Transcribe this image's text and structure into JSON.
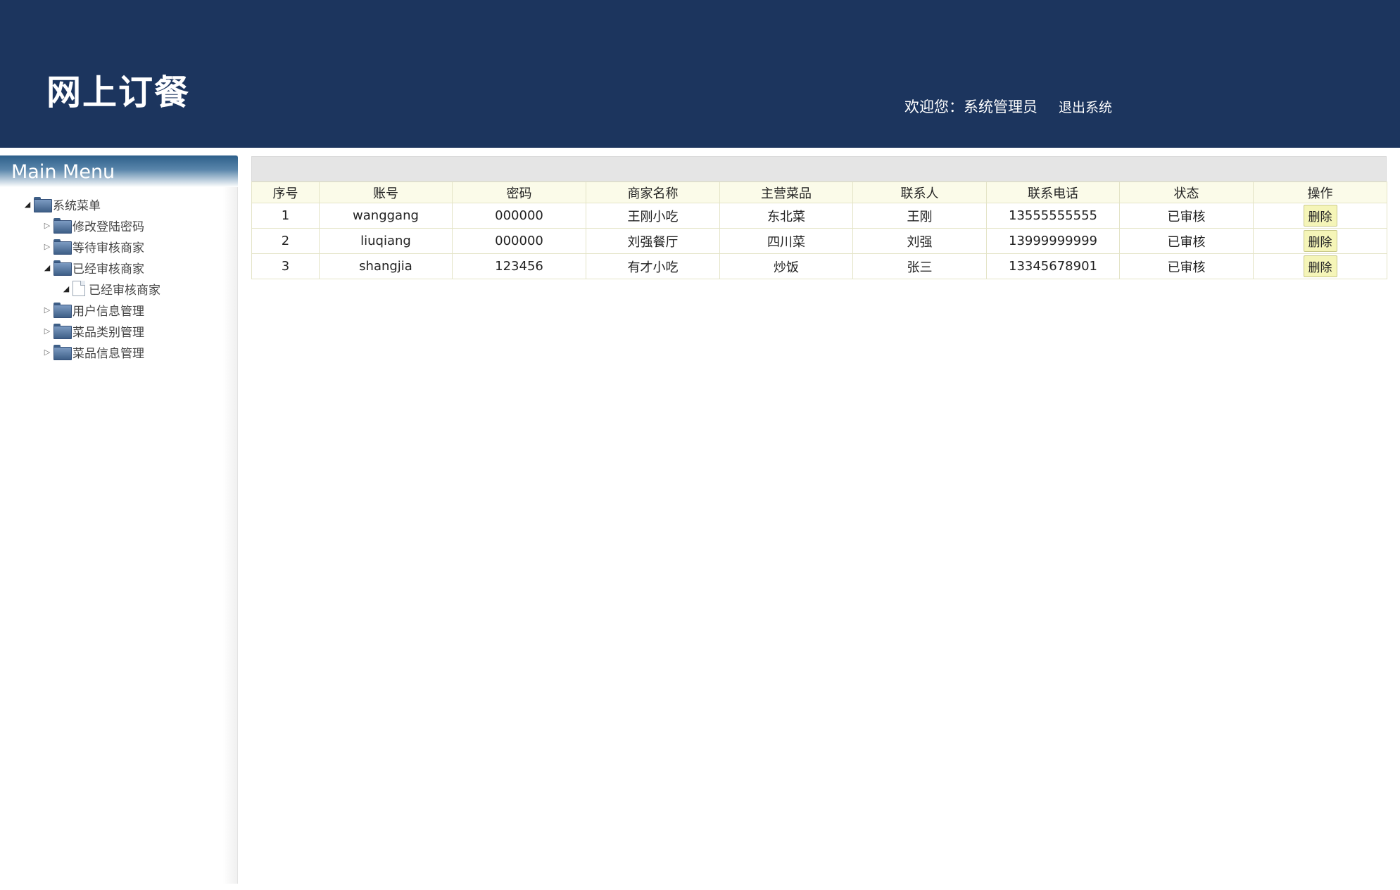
{
  "header": {
    "brand": "网上订餐",
    "welcome": "欢迎您：系统管理员",
    "logout": "退出系统"
  },
  "sidebar": {
    "title": "Main Menu",
    "root": {
      "label": "系统菜单",
      "state": "expanded"
    },
    "items": [
      {
        "label": "修改登陆密码",
        "state": "collapsed"
      },
      {
        "label": "等待审核商家",
        "state": "collapsed"
      },
      {
        "label": "已经审核商家",
        "state": "expanded"
      },
      {
        "label": "已经审核商家",
        "state": "leaf"
      },
      {
        "label": "用户信息管理",
        "state": "collapsed"
      },
      {
        "label": "菜品类别管理",
        "state": "collapsed"
      },
      {
        "label": "菜品信息管理",
        "state": "collapsed"
      }
    ]
  },
  "table": {
    "columns": [
      "序号",
      "账号",
      "密码",
      "商家名称",
      "主营菜品",
      "联系人",
      "联系电话",
      "状态",
      "操作"
    ],
    "rows": [
      [
        "1",
        "wanggang",
        "000000",
        "王刚小吃",
        "东北菜",
        "王刚",
        "13555555555",
        "已审核",
        "删除"
      ],
      [
        "2",
        "liuqiang",
        "000000",
        "刘强餐厅",
        "四川菜",
        "刘强",
        "13999999999",
        "已审核",
        "删除"
      ],
      [
        "3",
        "shangjia",
        "123456",
        "有才小吃",
        "炒饭",
        "张三",
        "13345678901",
        "已审核",
        "删除"
      ]
    ]
  },
  "colors": {
    "header_bg": "#1c355e",
    "table_header_bg": "#fbfbe9",
    "delete_button_bg": "#f5f5b8"
  }
}
